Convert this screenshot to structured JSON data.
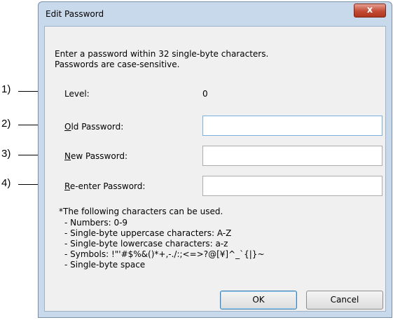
{
  "callouts": [
    "1)",
    "2)",
    "3)",
    "4)"
  ],
  "dialog": {
    "title": "Edit Password",
    "close_glyph": "x",
    "intro_line1": "Enter a password within 32 single-byte characters.",
    "intro_line2": "Passwords are case-sensitive.",
    "level_label": "Level:",
    "level_value": "0",
    "old_password_mnemonic": "O",
    "old_password_rest": "ld Password:",
    "new_password_mnemonic": "N",
    "new_password_rest": "ew Password:",
    "reenter_password_mnemonic": "R",
    "reenter_password_rest": "e-enter Password:",
    "old_password_value": "",
    "new_password_value": "",
    "reenter_password_value": "",
    "chars_heading": "*The following characters can be used.",
    "chars_items": [
      "- Numbers: 0-9",
      "- Single-byte uppercase characters: A-Z",
      "- Single-byte lowercase characters: a-z",
      "- Symbols: !\"'#$%&()*+,-./:;<=>?@[¥]^_`{|}~",
      "- Single-byte space"
    ],
    "ok_label": "OK",
    "cancel_label": "Cancel"
  }
}
